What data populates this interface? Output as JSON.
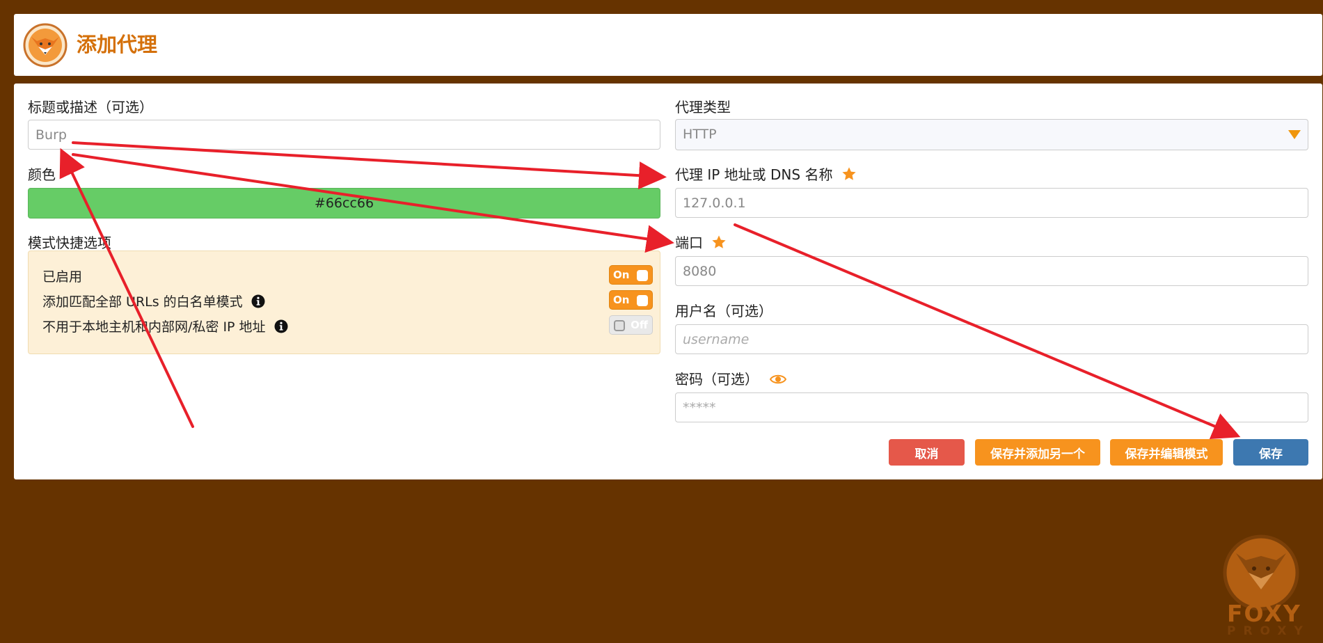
{
  "header": {
    "title": "添加代理"
  },
  "form": {
    "title_label": "标题或描述（可选）",
    "title_value": "Burp",
    "color_label": "颜色",
    "color_value": "#66cc66",
    "pattern_label": "模式快捷选项",
    "options": [
      {
        "label": "已启用",
        "state": "On",
        "info": false
      },
      {
        "label": "添加匹配全部 URLs 的白名单模式",
        "state": "On",
        "info": true
      },
      {
        "label": "不用于本地主机和内部网/私密 IP 地址",
        "state": "Off",
        "info": true
      }
    ],
    "type_label": "代理类型",
    "type_value": "HTTP",
    "ip_label": "代理 IP 地址或 DNS 名称",
    "ip_value": "127.0.0.1",
    "port_label": "端口",
    "port_value": "8080",
    "username_label": "用户名（可选）",
    "username_placeholder": "username",
    "password_label": "密码（可选）",
    "password_placeholder": "*****"
  },
  "buttons": {
    "cancel": "取消",
    "save_add": "保存并添加另一个",
    "save_edit": "保存并编辑模式",
    "save": "保存"
  },
  "watermark": {
    "line1": "FOXY",
    "line2": "PROXY"
  },
  "colors": {
    "accent": "#f7931e",
    "background": "#663300",
    "annotation": "#e8202a"
  },
  "icons": [
    "fox-logo-icon",
    "star-icon",
    "eye-icon",
    "info-icon",
    "chevron-down-icon"
  ]
}
